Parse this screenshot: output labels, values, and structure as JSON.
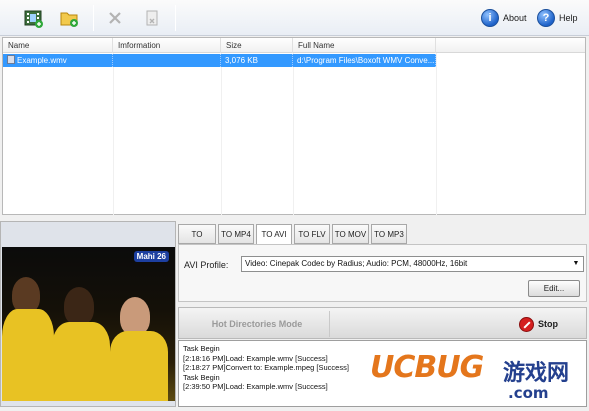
{
  "toolbar": {
    "about_label": "About",
    "help_label": "Help",
    "icons": [
      "add-video-icon",
      "add-folder-icon",
      "remove-icon",
      "clear-icon",
      "info-icon",
      "help-icon"
    ]
  },
  "filelist": {
    "headers": [
      "Name",
      "Imformation",
      "Size",
      "Full Name"
    ],
    "rows": [
      {
        "name": "Example.wmv",
        "information": "",
        "size": "3,076 KB",
        "full_name": "d:\\Program Files\\Boxoft WMV Conve..."
      }
    ]
  },
  "preview": {
    "logo_text": "Mahi 26"
  },
  "tabs": [
    "TO MPEG",
    "TO MP4",
    "TO AVI",
    "TO FLV",
    "TO MOV",
    "TO MP3"
  ],
  "active_tab": "TO AVI",
  "profile": {
    "label": "AVI Profile:",
    "value": "Video: Cinepak Codec by Radius; Audio: PCM, 48000Hz, 16bit",
    "edit_label": "Edit..."
  },
  "actions": {
    "hot_directories_label": "Hot Directories Mode",
    "stop_label": "Stop"
  },
  "log": [
    "Task Begin",
    "[2:18:16 PM]Load: Example.wmv [Success]",
    "[2:18:27 PM]Convert to: Example.mpeg [Success]",
    "Task Begin",
    "[2:39:50 PM]Load: Example.wmv [Success]"
  ],
  "watermark": {
    "main": "UCBUG",
    "cn": "游戏网",
    "com": ".com"
  },
  "colors": {
    "selection": "#3399ff",
    "stop_red": "#d41f1f",
    "watermark_orange": "#e4761c",
    "watermark_blue": "#24408e"
  }
}
